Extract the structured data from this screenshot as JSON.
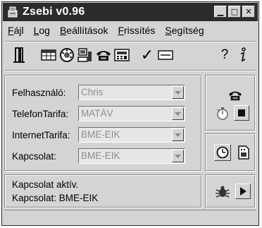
{
  "window": {
    "title": "Zsebi v0.96"
  },
  "titlebar": {
    "minimize_glyph": "▁",
    "restore_glyph": "□",
    "close_glyph": "✕"
  },
  "menu": [
    {
      "underline": "F",
      "rest": "ájl"
    },
    {
      "underline": "L",
      "rest": "og"
    },
    {
      "underline": "B",
      "rest": "eállítások"
    },
    {
      "underline": "F",
      "rest": "rissítés"
    },
    {
      "underline": "S",
      "rest": "egítség"
    }
  ],
  "toolbar": {
    "icons": [
      "exit-icon",
      "table-icon",
      "dial-icon",
      "computer-phone-icon",
      "phone-icon",
      "calculator-icon",
      "check-icon",
      "card-icon",
      "help-icon",
      "info-icon"
    ],
    "help_glyph": "?",
    "check_glyph": "✓"
  },
  "form": {
    "fields": [
      {
        "label": "Felhasználó:",
        "value": "Chris"
      },
      {
        "label": "TelefonTarifa:",
        "value": "MATÁV"
      },
      {
        "label": "InternetTarifa:",
        "value": "BME-EIK"
      },
      {
        "label": "Kapcsolat:",
        "value": "BME-EIK"
      }
    ]
  },
  "status": {
    "line1": "Kapcsolat aktív.",
    "line2": "Kapcsolat: BME-EIK"
  },
  "side_panels": {
    "top_icons": [
      "phone-icon",
      "stopwatch-icon",
      "stop-icon"
    ],
    "middle_icons": [
      "clock-icon",
      "calendar-icon"
    ],
    "bottom_icons": [
      "bug-icon",
      "play-icon"
    ]
  },
  "colors": {
    "titlebar": "#2c2c2c",
    "window_bg": "#d4d4d4",
    "disabled_text": "#8c8c8c"
  }
}
